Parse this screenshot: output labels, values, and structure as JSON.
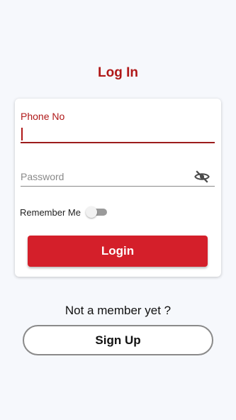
{
  "title": "Log In",
  "form": {
    "phone_label": "Phone No",
    "phone_value": "",
    "password_placeholder": "Password",
    "password_value": "",
    "visibility_icon": "eye-off-icon",
    "remember_label": "Remember Me",
    "remember_checked": false,
    "login_label": "Login"
  },
  "footer": {
    "prompt": "Not a member yet ?",
    "signup_label": "Sign Up"
  },
  "colors": {
    "accent": "#b01818",
    "button": "#d41f2a",
    "background": "#f6f8fc"
  }
}
